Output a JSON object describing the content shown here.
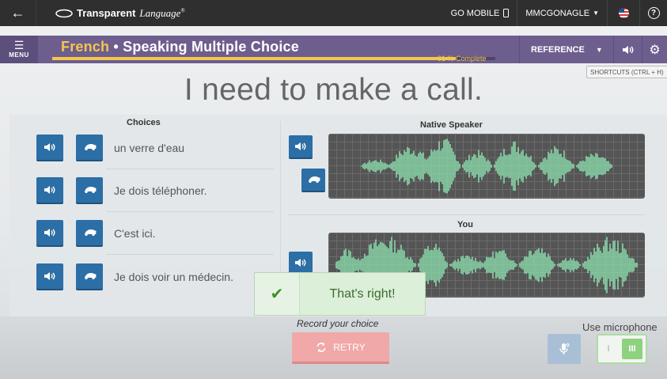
{
  "topbar": {
    "logo_brand": "Transparent",
    "logo_lang": "Language",
    "logo_reg": "®",
    "go_mobile": "GO MOBILE",
    "user": "MMCGONAGLE",
    "help": "?"
  },
  "purplebar": {
    "menu_label": "MENU",
    "title_lang": "French",
    "title_separator": " • ",
    "title_activity": "Speaking Multiple Choice",
    "progress_percent": 91,
    "progress_text": "91 % Complete",
    "reference_label": "REFERENCE"
  },
  "tooltip": {
    "shortcuts": "SHORTCUTS (CTRL + H)"
  },
  "prompt": "I need to make a call.",
  "choices": {
    "heading": "Choices",
    "items": [
      {
        "text": "un verre d'eau"
      },
      {
        "text": "Je dois téléphoner."
      },
      {
        "text": "C'est ici."
      },
      {
        "text": "Je dois voir un médecin."
      }
    ]
  },
  "native": {
    "heading": "Native Speaker"
  },
  "you": {
    "heading": "You"
  },
  "feedback": {
    "message": "That's right!"
  },
  "bottom": {
    "record_label": "Record your choice",
    "retry_label": "RETRY",
    "use_microphone": "Use microphone",
    "toggle_off": "I",
    "toggle_on": "III"
  },
  "colors": {
    "topbar": "#2f2f2f",
    "purplebar": "#6d5e8e",
    "accent_yellow": "#f2c74a",
    "button_blue": "#2c6ea6",
    "waveform": "#8fe8b4",
    "feedback_green": "#dcefd8",
    "retry_pink": "#f0a8a8"
  },
  "icons": {
    "back": "arrow-left-icon",
    "sound": "speaker-icon",
    "slow": "turtle-icon",
    "gear": "gear-icon",
    "retry": "refresh-icon",
    "mic": "microphone-icon",
    "check": "checkmark-icon"
  }
}
